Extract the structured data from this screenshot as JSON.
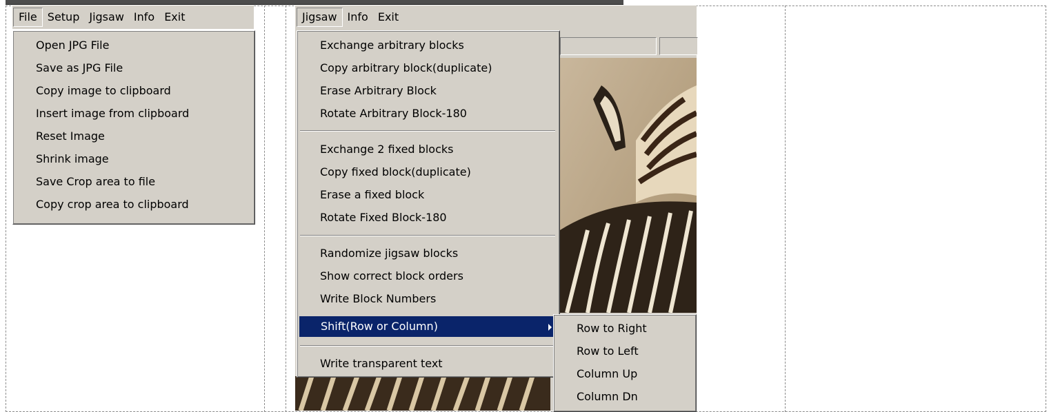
{
  "left_window": {
    "menubar": [
      "File",
      "Setup",
      "Jigsaw",
      "Info",
      "Exit"
    ],
    "open_menu": "File",
    "file_menu": [
      "Open JPG File",
      "Save as JPG File",
      "Copy image to clipboard",
      "Insert image from clipboard",
      "Reset Image",
      "Shrink image",
      "Save Crop area to file",
      "Copy crop area to clipboard"
    ]
  },
  "right_window": {
    "menubar": [
      "Jigsaw",
      "Info",
      "Exit"
    ],
    "open_menu": "Jigsaw",
    "jigsaw_menu": {
      "group1": [
        "Exchange arbitrary blocks",
        "Copy arbitrary block(duplicate)",
        "Erase Arbitrary Block",
        "Rotate Arbitrary Block-180"
      ],
      "group2": [
        "Exchange 2 fixed blocks",
        "Copy fixed block(duplicate)",
        "Erase a fixed block",
        "Rotate Fixed Block-180"
      ],
      "group3": [
        "Randomize jigsaw blocks",
        "Show correct block orders",
        "Write Block Numbers",
        "Shift(Row or Column)"
      ],
      "group4": [
        "Write transparent text"
      ]
    },
    "highlighted_item": "Shift(Row or Column)",
    "shift_submenu": [
      "Row to Right",
      "Row to Left",
      "Column Up",
      "Column Dn"
    ]
  },
  "colors": {
    "menu_bg": "#d4d0c8",
    "highlight": "#0a246a",
    "highlight_text": "#ffffff"
  }
}
